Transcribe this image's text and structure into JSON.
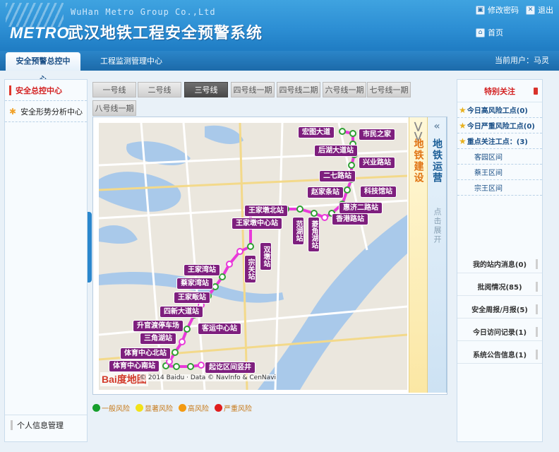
{
  "header": {
    "company": "WuHan Metro Group Co.,Ltd",
    "logo": "METRO",
    "title": "武汉地铁工程安全预警系统",
    "change_password": "修改密码",
    "logout": "退出",
    "home": "首页"
  },
  "nav": {
    "tab_alert": "安全预警总控中心",
    "tab_monitor": "工程监测管理中心",
    "current_user": "当前用户：马灵"
  },
  "left_menu": {
    "item1": "安全总控中心",
    "item2": "安全形势分析中心",
    "personal": "个人信息管理"
  },
  "lines": {
    "l1": "一号线",
    "l2": "二号线",
    "l3": "三号线",
    "l4a": "四号线一期",
    "l4b": "四号线二期",
    "l6": "六号线一期",
    "l7": "七号线一期",
    "l8": "八号线一期"
  },
  "map": {
    "baidu": "Bai度地图",
    "copyright": "© 2014 Baidu · Data © NavInfo & CenNavi"
  },
  "stations": {
    "s1": "宏图大道",
    "s2": "市民之家",
    "s3": "后湖大道站",
    "s4": "兴业路站",
    "s5": "二七路站",
    "s6": "赵家条站",
    "s7": "科技馆站",
    "s8": "惠济二路站",
    "s9": "王家墩北站",
    "s10": "香港路站",
    "s11": "王家墩中心站",
    "s12": "范湖站",
    "s13": "菱角湖站",
    "s14": "双墩站",
    "s15": "宗关站",
    "s16": "王家湾站",
    "s17": "蔡家湾站",
    "s18": "王家畈站",
    "s19": "四新大道站",
    "s20": "升官渡停车场",
    "s21": "三角湖站",
    "s22": "客运中心站",
    "s23": "体育中心北站",
    "s24": "体育中心南站",
    "s25": "起讫区间竖井"
  },
  "side": {
    "construction": "地铁建设",
    "operation": "地铁运营",
    "hint": "点击展开"
  },
  "legend": {
    "normal": "一般风险",
    "notable": "显著风险",
    "high": "高风险",
    "severe": "严重风险"
  },
  "right": {
    "focus_title": "特别关注",
    "today_high": "今日高风险工点(0)",
    "today_severe": "今日严重风险工点(0)",
    "key_focus": "重点关注工点：(3)",
    "sub1": "客园区间",
    "sub2": "蔡王区间",
    "sub3": "宗王区间",
    "msg": "我的站内消息(0)",
    "review": "批阅情况(85)",
    "report": "安全周报/月报(5)",
    "visit": "今日访问记录(1)",
    "notice": "系统公告信息(1)"
  },
  "colors": {
    "accent": "#2d8fd4",
    "line": "#e83ad9",
    "station": "#7e1f7e",
    "normal": "#169e2c",
    "notable": "#f2e219",
    "high": "#f39a12",
    "severe": "#e01e1e"
  },
  "icons": {
    "change_password": "lock-icon",
    "logout": "close-icon",
    "home": "home-icon"
  }
}
